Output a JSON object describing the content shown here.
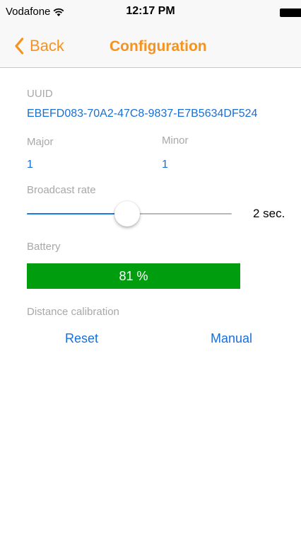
{
  "status_bar": {
    "carrier": "Vodafone",
    "time": "12:17 PM",
    "icons": [
      "wifi-icon",
      "battery-icon"
    ]
  },
  "nav": {
    "back_label": "Back",
    "title": "Configuration",
    "accent_color": "#f7921e"
  },
  "uuid": {
    "label": "UUID",
    "value": "EBEFD083-70A2-47C8-9837-E7B5634DF524"
  },
  "major": {
    "label": "Major",
    "value": "1"
  },
  "minor": {
    "label": "Minor",
    "value": "1"
  },
  "broadcast_rate": {
    "label": "Broadcast rate",
    "value_text": "2 sec.",
    "slider_fraction": 0.49
  },
  "battery": {
    "label": "Battery",
    "percent_text": "81 %",
    "fill_fraction": 1.0,
    "fill_color": "#009e0f"
  },
  "distance_calibration": {
    "label": "Distance calibration",
    "reset_label": "Reset",
    "manual_label": "Manual"
  },
  "colors": {
    "link": "#1a6fd6",
    "label": "#a8a8a8"
  }
}
